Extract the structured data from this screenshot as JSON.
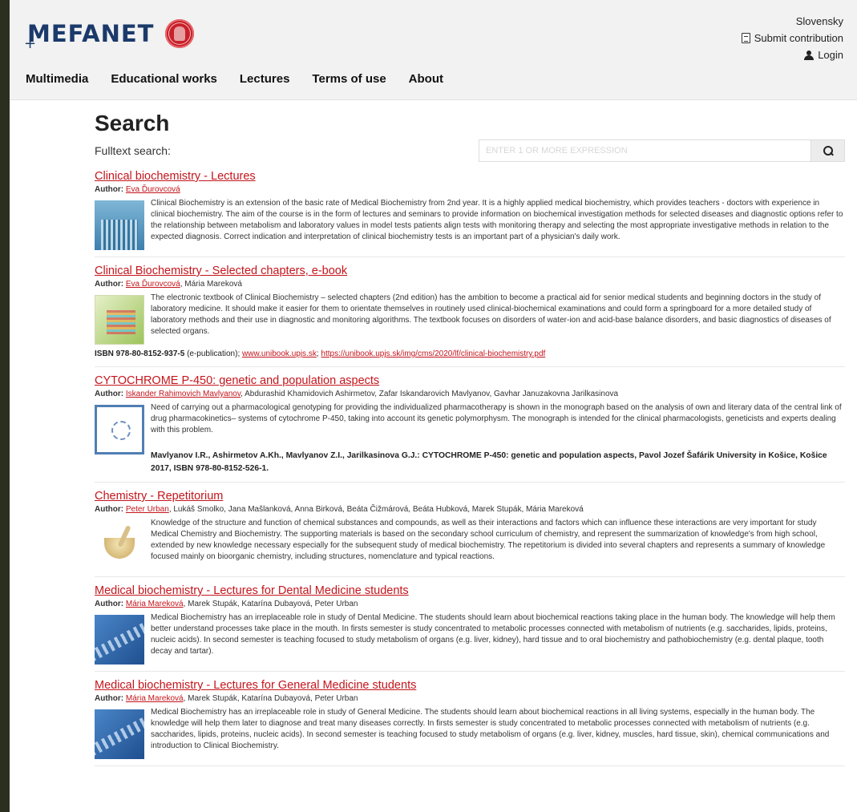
{
  "header": {
    "logo_text": "MEFANET",
    "language": "Slovensky",
    "submit_label": "Submit contribution",
    "login_label": "Login"
  },
  "nav": [
    "Multimedia",
    "Educational works",
    "Lectures",
    "Terms of use",
    "About"
  ],
  "search": {
    "title": "Search",
    "label": "Fulltext search:",
    "placeholder": "ENTER 1 OR MORE EXPRESSION",
    "button_icon": "search-icon"
  },
  "results": [
    {
      "title": "Clinical biochemistry - Lectures",
      "author_label": "Author:",
      "author_link": "Eva Ďurovcová",
      "authors_rest": "",
      "thumb": "lab",
      "description": "Clinical Biochemistry is an extension of the basic rate of Medical Biochemistry from 2nd year. It is a highly applied medical biochemistry, which provides teachers - doctors with experience in clinical biochemistry. The aim of the course is in the form of lectures and seminars to provide information on biochemical investigation methods for selected diseases and diagnostic options refer to the relationship between metabolism and laboratory values in model tests patients align tests with monitoring therapy and selecting the most appropriate investigative methods in relation to the expected diagnosis. Correct indication and interpretation of clinical biochemistry tests is an important part of a physician's daily work."
    },
    {
      "title": "Clinical Biochemistry - Selected chapters, e-book",
      "author_label": "Author:",
      "author_link": "Eva Ďurovcová",
      "authors_rest": ", Mária Mareková",
      "thumb": "book",
      "description": "The electronic textbook of Clinical Biochemistry – selected chapters (2nd edition) has the ambition to become a practical aid for senior medical students and beginning doctors in the study of laboratory medicine. It should make it easier for them to orientate themselves in routinely used clinical-biochemical examinations and could form a springboard for a more detailed study of laboratory methods and their use in diagnostic and monitoring algorithms. The textbook focuses on disorders of water-ion and acid-base balance disorders, and basic diagnostics of diseases of selected organs.",
      "isbn_bold": "ISBN 978-80-8152-937-5",
      "isbn_rest": " (e-publication); ",
      "link1": "www.unibook.upjs.sk",
      "sep": "; ",
      "link2": "https://unibook.upjs.sk/img/cms/2020/lf/clinical-biochemistry.pdf"
    },
    {
      "title": "CYTOCHROME P-450: genetic and population aspects",
      "author_label": "Author:",
      "author_link": "Iskander Rahimovich Mavlyanov",
      "authors_rest": ", Abdurashid Khamidovich Ashirmetov, Zafar Iskandarovich Mavlyanov, Gavhar Januzakovna Jarilkasinova",
      "thumb": "diag",
      "description": "Need of carrying out a pharmacological genotyping for providing the individualized pharmacotherapy is shown in the monograph based on the analysis of own and literary data of the central link of drug pharmacokinetics– systems of cytochrome P-450, taking into account its genetic polymorphysm. The monograph is intended for the clinical pharmacologists, geneticists and experts dealing with this problem.",
      "citation": "Mavlyanov I.R., Ashirmetov A.Kh., Mavlyanov Z.I., Jarilkasinova G.J.: CYTOCHROME P-450: genetic and population aspects, Pavol Jozef Šafárik University in Košice, Košice 2017, ISBN 978-80-8152-526-1."
    },
    {
      "title": "Chemistry - Repetitorium",
      "author_label": "Author:",
      "author_link": "Peter Urban",
      "authors_rest": ", Lukáš Smolko, Jana Mašlanková, Anna Birková, Beáta Čižmárová, Beáta Hubková, Marek Stupák, Mária Mareková",
      "thumb": "mortar",
      "description": "Knowledge of the structure and function of chemical substances and compounds, as well as their interactions and factors which can influence these interactions are very important for study Medical Chemistry and Biochemistry. The supporting materials is based on the secondary school curriculum of chemistry, and represent the summarization of knowledge's from high school, extended by new knowledge necessary especially for the subsequent study of medical biochemistry. The repetitorium is divided into several chapters and represents a summary of knowledge focused mainly on bioorganic chemistry, including structures, nomenclature and typical reactions."
    },
    {
      "title": "Medical biochemistry - Lectures for Dental Medicine students",
      "author_label": "Author:",
      "author_link": "Mária Mareková",
      "authors_rest": ", Marek Stupák, Katarína Dubayová, Peter Urban",
      "thumb": "dna",
      "description": "Medical Biochemistry has an irreplaceable role in study of Dental Medicine. The students should learn about biochemical reactions taking place in the human body. The knowledge will help them better understand processes take place in the mouth. In firsts semester is study concentrated to metabolic processes connected with metabolism of nutrients (e.g. saccharides, lipids, proteins, nucleic acids). In second semester is teaching focused to study metabolism of organs (e.g. liver, kidney), hard tissue and to oral biochemistry and pathobiochemistry (e.g. dental plaque, tooth decay and tartar)."
    },
    {
      "title": "Medical biochemistry - Lectures for General Medicine students",
      "author_label": "Author:",
      "author_link": "Mária Mareková",
      "authors_rest": ", Marek Stupák, Katarína Dubayová, Peter Urban",
      "thumb": "dna",
      "description": "Medical Biochemistry has an irreplaceable role in study of General Medicine. The students should learn about biochemical reactions in all living systems, especially in the human body. The knowledge will help them later to diagnose and treat many diseases correctly. In firsts semester is study concentrated to metabolic processes connected with metabolism of nutrients (e.g. saccharides, lipids, proteins, nucleic acids). In second semester is teaching focused to study metabolism of organs (e.g. liver, kidney, muscles, hard tissue, skin), chemical communications and introduction to Clinical Biochemistry."
    }
  ]
}
